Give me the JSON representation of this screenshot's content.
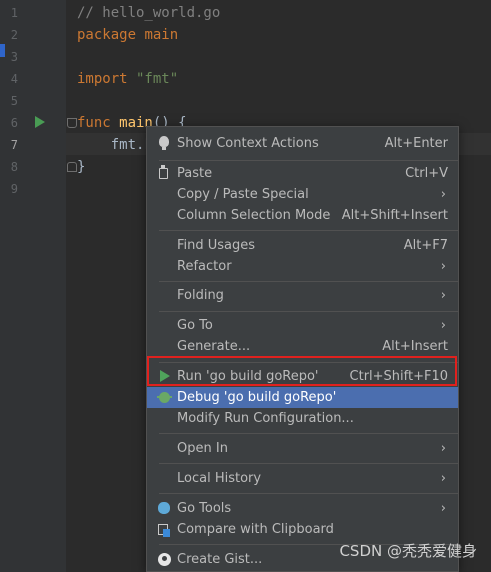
{
  "editor": {
    "line_numbers": [
      "1",
      "2",
      "3",
      "4",
      "5",
      "6",
      "7",
      "8",
      "9"
    ],
    "code": {
      "line1_comment": "// hello_world.go",
      "line2_kw": "package",
      "line2_ident": " main",
      "line4_kw": "import",
      "line4_str": " \"fmt\"",
      "line6_kw": "func",
      "line6_fn": " main",
      "line6_rest": "() {",
      "line7": "    fmt.F",
      "line8": "}"
    }
  },
  "context_menu": {
    "items": [
      {
        "label": "Show Context Actions",
        "shortcut": "Alt+Enter",
        "icon": "lightbulb-icon"
      },
      {
        "label": "Paste",
        "shortcut": "Ctrl+V",
        "icon": "clipboard-icon"
      },
      {
        "label": "Copy / Paste Special",
        "arrow": "›"
      },
      {
        "label": "Column Selection Mode",
        "shortcut": "Alt+Shift+Insert"
      },
      {
        "label": "Find Usages",
        "shortcut": "Alt+F7"
      },
      {
        "label": "Refactor",
        "arrow": "›"
      },
      {
        "label": "Folding",
        "arrow": "›"
      },
      {
        "label": "Go To",
        "arrow": "›"
      },
      {
        "label": "Generate...",
        "shortcut": "Alt+Insert"
      },
      {
        "label": "Run 'go build goRepo'",
        "shortcut": "Ctrl+Shift+F10",
        "icon": "run-icon"
      },
      {
        "label": "Debug 'go build goRepo'",
        "icon": "debug-icon",
        "selected": true
      },
      {
        "label": "Modify Run Configuration..."
      },
      {
        "label": "Open In",
        "arrow": "›"
      },
      {
        "label": "Local History",
        "arrow": "›"
      },
      {
        "label": "Go Tools",
        "arrow": "›",
        "icon": "gopher-icon"
      },
      {
        "label": "Compare with Clipboard",
        "icon": "compare-icon"
      },
      {
        "label": "Create Gist...",
        "icon": "github-icon"
      }
    ]
  },
  "watermark": "CSDN @秃秃爱健身",
  "colors": {
    "selection": "#4b6eaf",
    "highlight_box": "#e0211e",
    "menu_bg": "#3c3f41",
    "editor_bg": "#2b2b2b"
  }
}
